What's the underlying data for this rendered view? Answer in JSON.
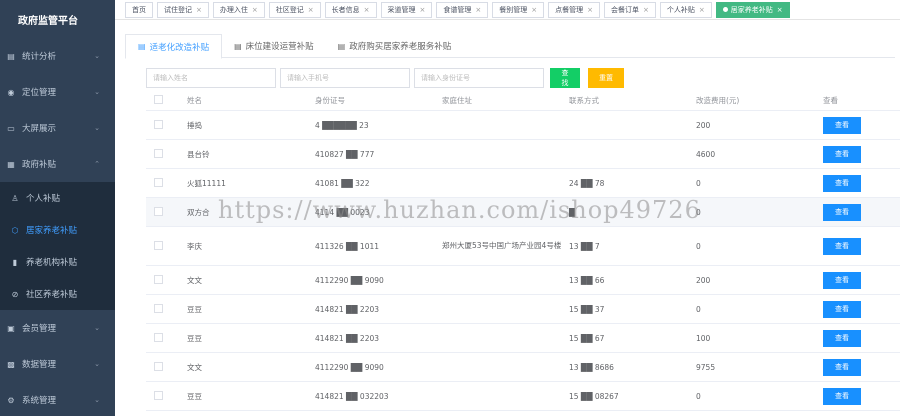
{
  "app": {
    "title": "政府监管平台"
  },
  "sidebar": {
    "items": [
      {
        "label": "统计分析",
        "icon": "chart-icon",
        "glyph": "▤",
        "arrow": "⌄"
      },
      {
        "label": "定位管理",
        "icon": "location-icon",
        "glyph": "◉",
        "arrow": "⌄"
      },
      {
        "label": "大屏展示",
        "icon": "screen-icon",
        "glyph": "▭",
        "arrow": "⌄"
      },
      {
        "label": "政府补贴",
        "icon": "subsidy-icon",
        "glyph": "▦",
        "arrow": "⌃"
      }
    ],
    "sub_items": [
      {
        "label": "个人补贴",
        "icon": "person-icon",
        "glyph": "♙"
      },
      {
        "label": "居家养老补贴",
        "icon": "cube-icon",
        "glyph": "⬡"
      },
      {
        "label": "养老机构补贴",
        "icon": "bar-chart-icon",
        "glyph": "▮"
      },
      {
        "label": "社区养老补贴",
        "icon": "link-icon",
        "glyph": "⊘"
      }
    ],
    "bottom_items": [
      {
        "label": "会员管理",
        "icon": "member-icon",
        "glyph": "▣",
        "arrow": "⌄"
      },
      {
        "label": "数据管理",
        "icon": "data-icon",
        "glyph": "▩",
        "arrow": "⌄"
      },
      {
        "label": "系统管理",
        "icon": "system-icon",
        "glyph": "⚙",
        "arrow": "⌄"
      }
    ]
  },
  "tagbar": {
    "tags": [
      "首页",
      "试住登记",
      "办理入住",
      "社区登记",
      "长者信息",
      "采道管理",
      "食谱管理",
      "餐别管理",
      "点餐管理",
      "会餐订单",
      "个人补贴",
      "居家养老补贴"
    ],
    "close_glyph": "×"
  },
  "tabs": [
    {
      "label": "适老化改造补贴",
      "icon": "table-icon",
      "glyph": "▤"
    },
    {
      "label": "床位建设运营补贴",
      "icon": "table-icon",
      "glyph": "▤"
    },
    {
      "label": "政府购买居家养老服务补贴",
      "icon": "table-icon",
      "glyph": "▤"
    }
  ],
  "filters": {
    "name_placeholder": "请输入姓名",
    "phone_placeholder": "请输入手机号",
    "id_placeholder": "请输入身份证号",
    "search_label": "查找",
    "reset_label": "重置"
  },
  "table": {
    "headers": {
      "name": "姓名",
      "id": "身份证号",
      "address": "家庭住址",
      "phone": "联系方式",
      "cost": "改造费用(元)",
      "action": "查看"
    },
    "action_label": "查看",
    "rows": [
      {
        "name": "捶捣",
        "id": "4 ██████ 23",
        "address": "",
        "phone": "",
        "cost": "200"
      },
      {
        "name": "县台铃",
        "id": "410827 ██ 777",
        "address": "",
        "phone": "",
        "cost": "4600"
      },
      {
        "name": "火狐11111",
        "id": "41081 ██ 322",
        "address": "",
        "phone": "24 ██ 78",
        "cost": "0"
      },
      {
        "name": "双方合",
        "id": "4114 ██ 0023",
        "address": "",
        "phone": "█",
        "cost": "0"
      },
      {
        "name": "李庆",
        "id": "411326 ██ 1011",
        "address": "郑州大厦53号中国广场产业园4号楼",
        "phone": "13 ██ 7",
        "cost": "0"
      },
      {
        "name": "文文",
        "id": "4112290 ██ 9090",
        "address": "",
        "phone": "13 ██ 66",
        "cost": "200"
      },
      {
        "name": "豆豆",
        "id": "414821 ██ 2203",
        "address": "",
        "phone": "15 ██ 37",
        "cost": "0"
      },
      {
        "name": "豆豆",
        "id": "414821 ██ 2203",
        "address": "",
        "phone": "15 ██ 67",
        "cost": "100"
      },
      {
        "name": "文文",
        "id": "4112290 ██ 9090",
        "address": "",
        "phone": "13 ██ 8686",
        "cost": "9755"
      },
      {
        "name": "豆豆",
        "id": "414821 ██ 032203",
        "address": "",
        "phone": "15 ██ 08267",
        "cost": "0"
      }
    ]
  },
  "watermark": "https://www.huzhan.com/ishop49726"
}
